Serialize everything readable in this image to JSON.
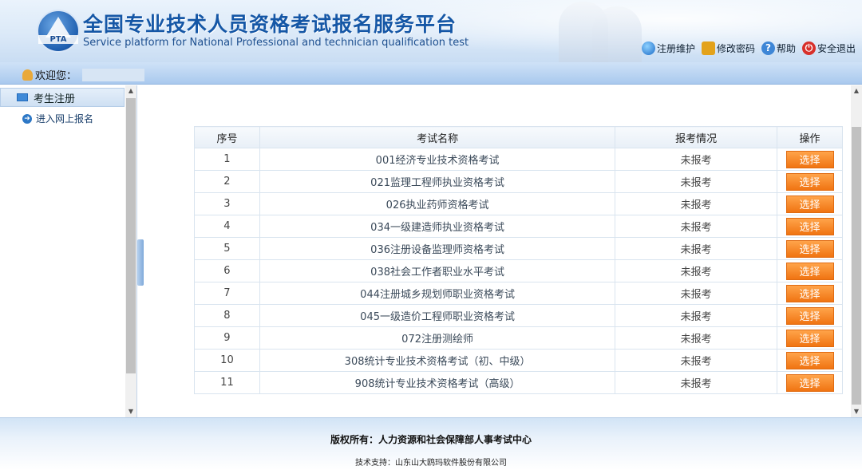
{
  "header": {
    "title_cn": "全国专业技术人员资格考试报名服务平台",
    "title_en": "Service platform for National Professional and technician qualification test",
    "logo_text": "PTA",
    "links": [
      {
        "label": "注册维护",
        "icon": "globe-icon"
      },
      {
        "label": "修改密码",
        "icon": "lock-icon"
      },
      {
        "label": "帮助",
        "icon": "help-icon"
      },
      {
        "label": "安全退出",
        "icon": "power-icon"
      }
    ]
  },
  "welcome": {
    "label": "欢迎您："
  },
  "sidebar": {
    "section_title": "考生注册",
    "items": [
      {
        "label": "进入网上报名"
      }
    ]
  },
  "table": {
    "headers": [
      "序号",
      "考试名称",
      "报考情况",
      "操作"
    ],
    "rows": [
      {
        "no": "1",
        "name": "001经济专业技术资格考试",
        "status": "未报考",
        "action": "选择"
      },
      {
        "no": "2",
        "name": "021监理工程师执业资格考试",
        "status": "未报考",
        "action": "选择"
      },
      {
        "no": "3",
        "name": "026执业药师资格考试",
        "status": "未报考",
        "action": "选择"
      },
      {
        "no": "4",
        "name": "034一级建造师执业资格考试",
        "status": "未报考",
        "action": "选择"
      },
      {
        "no": "5",
        "name": "036注册设备监理师资格考试",
        "status": "未报考",
        "action": "选择"
      },
      {
        "no": "6",
        "name": "038社会工作者职业水平考试",
        "status": "未报考",
        "action": "选择"
      },
      {
        "no": "7",
        "name": "044注册城乡规划师职业资格考试",
        "status": "未报考",
        "action": "选择"
      },
      {
        "no": "8",
        "name": "045一级造价工程师职业资格考试",
        "status": "未报考",
        "action": "选择"
      },
      {
        "no": "9",
        "name": "072注册测绘师",
        "status": "未报考",
        "action": "选择"
      },
      {
        "no": "10",
        "name": "308统计专业技术资格考试（初、中级）",
        "status": "未报考",
        "action": "选择"
      },
      {
        "no": "11",
        "name": "908统计专业技术资格考试（高级）",
        "status": "未报考",
        "action": "选择"
      }
    ]
  },
  "footer": {
    "copyright": "版权所有：人力资源和社会保障部人事考试中心",
    "tech": "技术支持：山东山大鸥玛软件股份有限公司"
  },
  "colors": {
    "accent": "#1557a6",
    "button": "#f58a22"
  }
}
